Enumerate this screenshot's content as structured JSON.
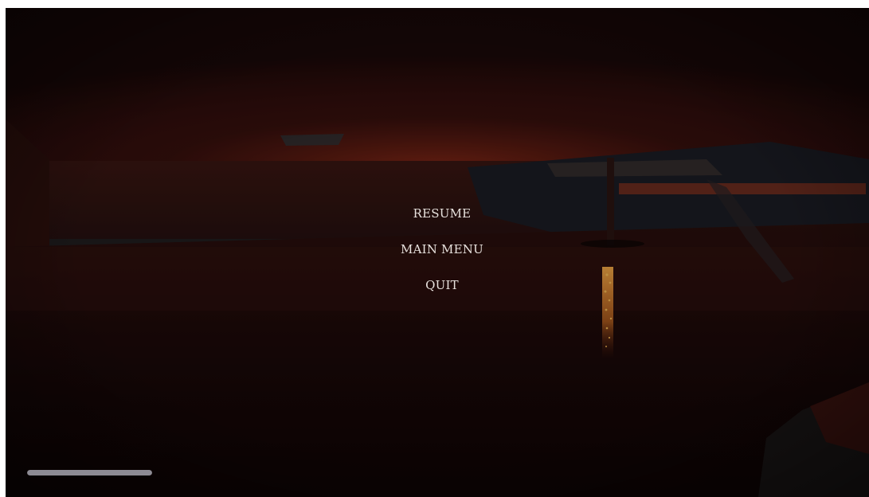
{
  "pause_menu": {
    "items": [
      {
        "label": "RESUME"
      },
      {
        "label": "MAIN MENU"
      },
      {
        "label": "QUIT"
      }
    ]
  },
  "hud": {
    "stamina_fraction": 1.0
  },
  "colors": {
    "menu_text": "#e8e2de",
    "ambient_red": "#a3301a",
    "ember_orange": "#ffb24a"
  }
}
